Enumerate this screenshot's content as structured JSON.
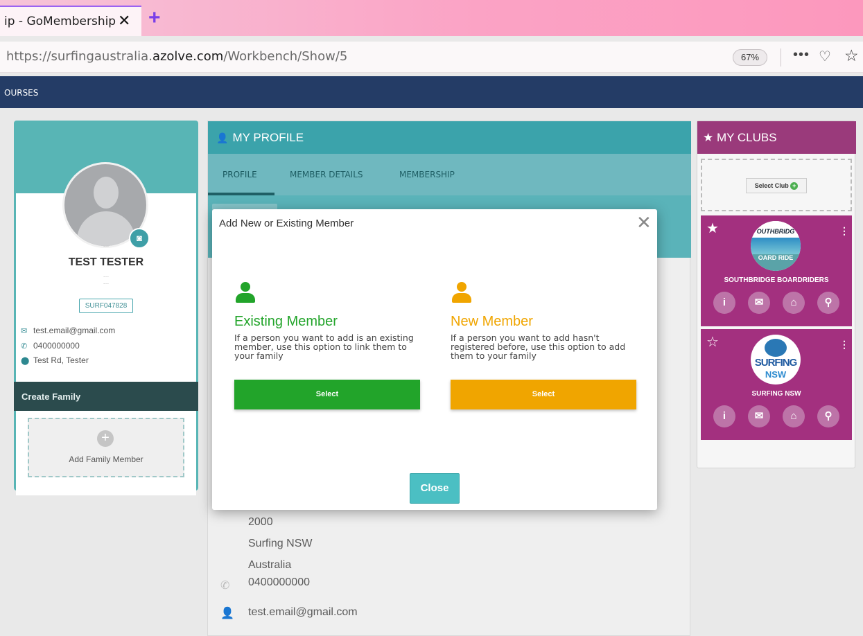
{
  "browser": {
    "tab_title": "ip - GoMembership",
    "tab_close": "✕",
    "new_tab": "+",
    "url_prefix": "https://surfingaustralia.",
    "url_host": "azolve.com",
    "url_path": "/Workbench/Show/5",
    "zoom": "67%"
  },
  "appnav": {
    "item": "OURSES"
  },
  "profile_card": {
    "name": "TEST TESTER",
    "member_code": "SURF047828",
    "email": "test.email@gmail.com",
    "phone": "0400000000",
    "address": "Test Rd, Tester",
    "create_family": "Create Family",
    "add_family_member": "Add Family Member"
  },
  "my_profile": {
    "title": "MY PROFILE",
    "tabs": [
      "PROFILE",
      "MEMBER DETAILS",
      "MEMBERSHIP"
    ],
    "postcode": "2000",
    "state": "Surfing NSW",
    "country": "Australia",
    "phone": "0400000000",
    "email": "test.email@gmail.com"
  },
  "my_clubs": {
    "title": "MY CLUBS",
    "select_club": "Select Club",
    "clubs": [
      {
        "name": "SOUTHBRIDGE BOARDRIDERS",
        "favourite": true,
        "logo_text_top": "OUTHBRIDG",
        "logo_text_bottom": "OARD RIDE"
      },
      {
        "name": "SURFING NSW",
        "favourite": false,
        "logo_text_top": "SURFING",
        "logo_text_bottom": "NSW"
      }
    ]
  },
  "modal": {
    "title": "Add New or Existing Member",
    "existing": {
      "title_word1": "Existing",
      "title_word2": "Member",
      "description": "If a person you want to add is an existing member, use this option to link them to your family",
      "button": "Select",
      "color": "#22a42a"
    },
    "new": {
      "title_word1": "New",
      "title_word2": "Member",
      "description": "If a person you want to add hasn't registered before, use this option to add them to your family",
      "button": "Select",
      "color": "#f0a500"
    },
    "close_button": "Close"
  }
}
